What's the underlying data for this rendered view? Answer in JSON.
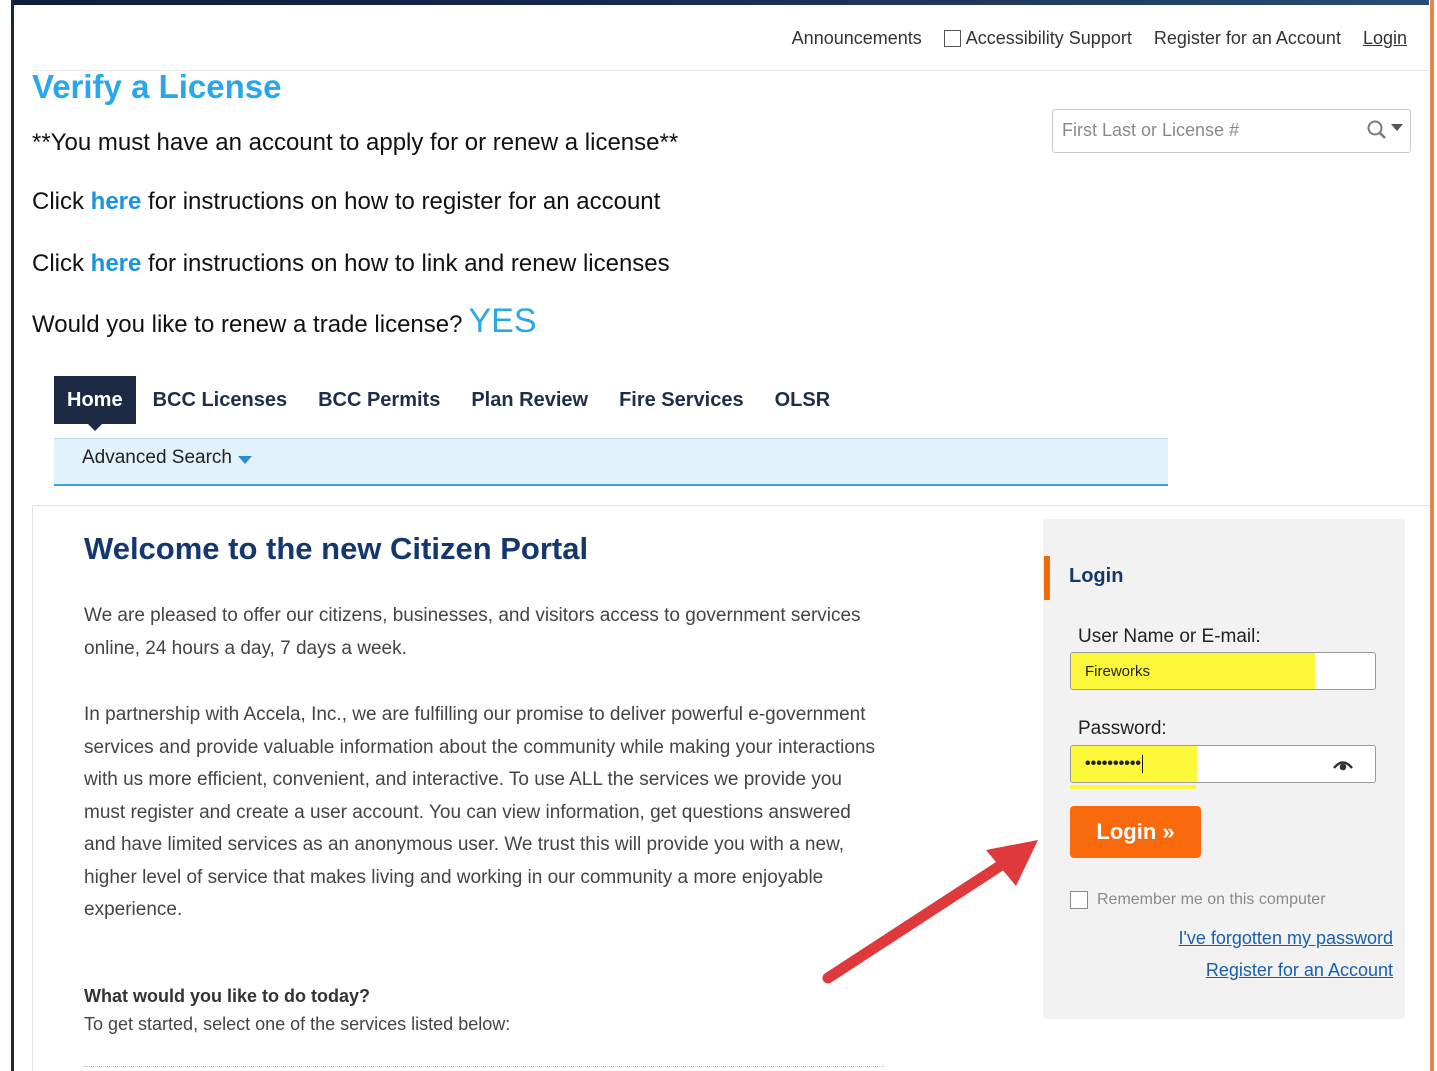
{
  "top_links": {
    "announcements": "Announcements",
    "accessibility": "Accessibility Support",
    "register": "Register for an Account",
    "login": "Login"
  },
  "search": {
    "placeholder": "First Last or License #"
  },
  "verify": {
    "title": "Verify a License",
    "notice": "**You must have an account to apply for or renew a license**",
    "line1_prefix": "Click ",
    "line1_link": "here",
    "line1_suffix": " for instructions on how to register for an account",
    "line2_prefix": "Click ",
    "line2_link": "here",
    "line2_suffix": " for instructions on how to link and renew licenses",
    "renew_question": "Would you like to renew a trade license?",
    "renew_yes": "YES"
  },
  "nav": {
    "tabs": [
      "Home",
      "BCC Licenses",
      "BCC Permits",
      "Plan Review",
      "Fire Services",
      "OLSR"
    ],
    "advanced_search": "Advanced Search"
  },
  "welcome": {
    "title": "Welcome to the new Citizen Portal",
    "para1": "We are pleased to offer our citizens, businesses, and visitors access to government services online, 24 hours a day, 7 days a week.",
    "para2": "In partnership with Accela, Inc., we are fulfilling our promise to deliver powerful e-government services and provide valuable information about the community while making your interactions with us more efficient, convenient, and interactive. To use ALL the services we provide you must register and create a user account. You can view information, get questions answered and have limited services as an anonymous user. We trust this will provide you with a new, higher level of service that makes living and working in our community a more enjoyable experience.",
    "todo_title": "What would you like to do today?",
    "todo_sub": "To get started, select one of the services listed below:"
  },
  "login_panel": {
    "heading": "Login",
    "username_label": "User Name or E-mail:",
    "username_value": "Fireworks",
    "password_label": "Password:",
    "password_mask": "••••••••••",
    "login_button": "Login »",
    "remember": "Remember me on this computer",
    "forgot": "I've forgotten my password",
    "register": "Register for an Account"
  },
  "colors": {
    "brand_blue": "#29a7ea",
    "navy": "#14386d",
    "login_orange": "#f86a0d",
    "highlight_yellow": "#fdf83a"
  }
}
